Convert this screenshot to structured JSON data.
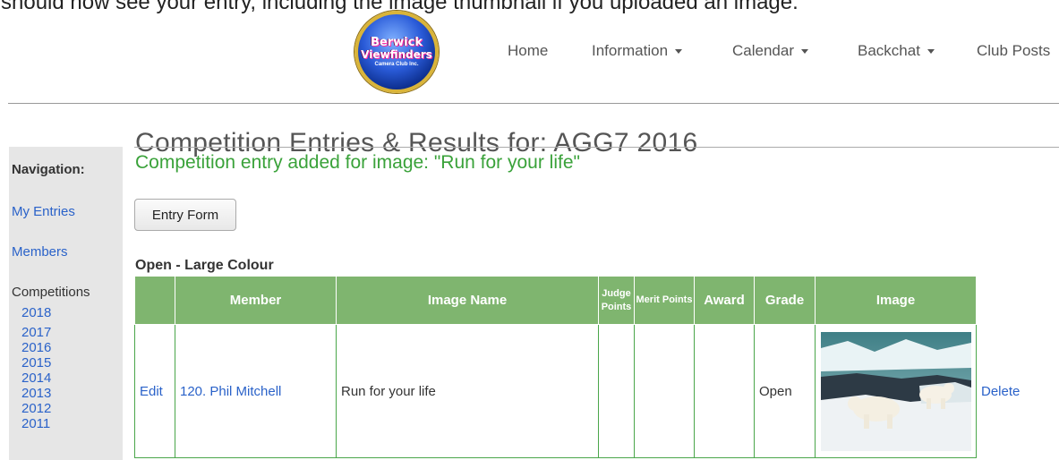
{
  "intro_text": "should now see your entry, including the image thumbnail if you uploaded an image.",
  "logo": {
    "line1": "Berwick",
    "line2": "Viewfinders",
    "line3": "Camera Club Inc."
  },
  "nav": {
    "home": "Home",
    "information": "Information",
    "calendar": "Calendar",
    "backchat": "Backchat",
    "club_posts": "Club Posts"
  },
  "page_title": "Competition Entries & Results for: AGG7 2016",
  "sidebar": {
    "heading": "Navigation:",
    "my_entries": "My Entries",
    "members": "Members",
    "competitions_label": "Competitions",
    "years": [
      "2018",
      "2017",
      "2016",
      "2015",
      "2014",
      "2013",
      "2012",
      "2011"
    ]
  },
  "success_message": "Competition entry added for image: \"Run for your life\"",
  "entry_form_button": "Entry Form",
  "section_title": "Open - Large Colour",
  "table": {
    "headers": {
      "member": "Member",
      "image_name": "Image Name",
      "judge_points": "Judge Points",
      "merit_points": "Merit Points",
      "award": "Award",
      "grade": "Grade",
      "image": "Image"
    },
    "rows": [
      {
        "edit": "Edit",
        "member": "120. Phil Mitchell",
        "image_name": "Run for your life",
        "judge_points": "",
        "merit_points": "",
        "award": "",
        "grade": "Open",
        "delete": "Delete"
      }
    ]
  },
  "colors": {
    "header_green": "#7fb56f",
    "success_green": "#3aa23a",
    "link_blue": "#2a62c9",
    "sidebar_gray": "#e6e6e6"
  }
}
